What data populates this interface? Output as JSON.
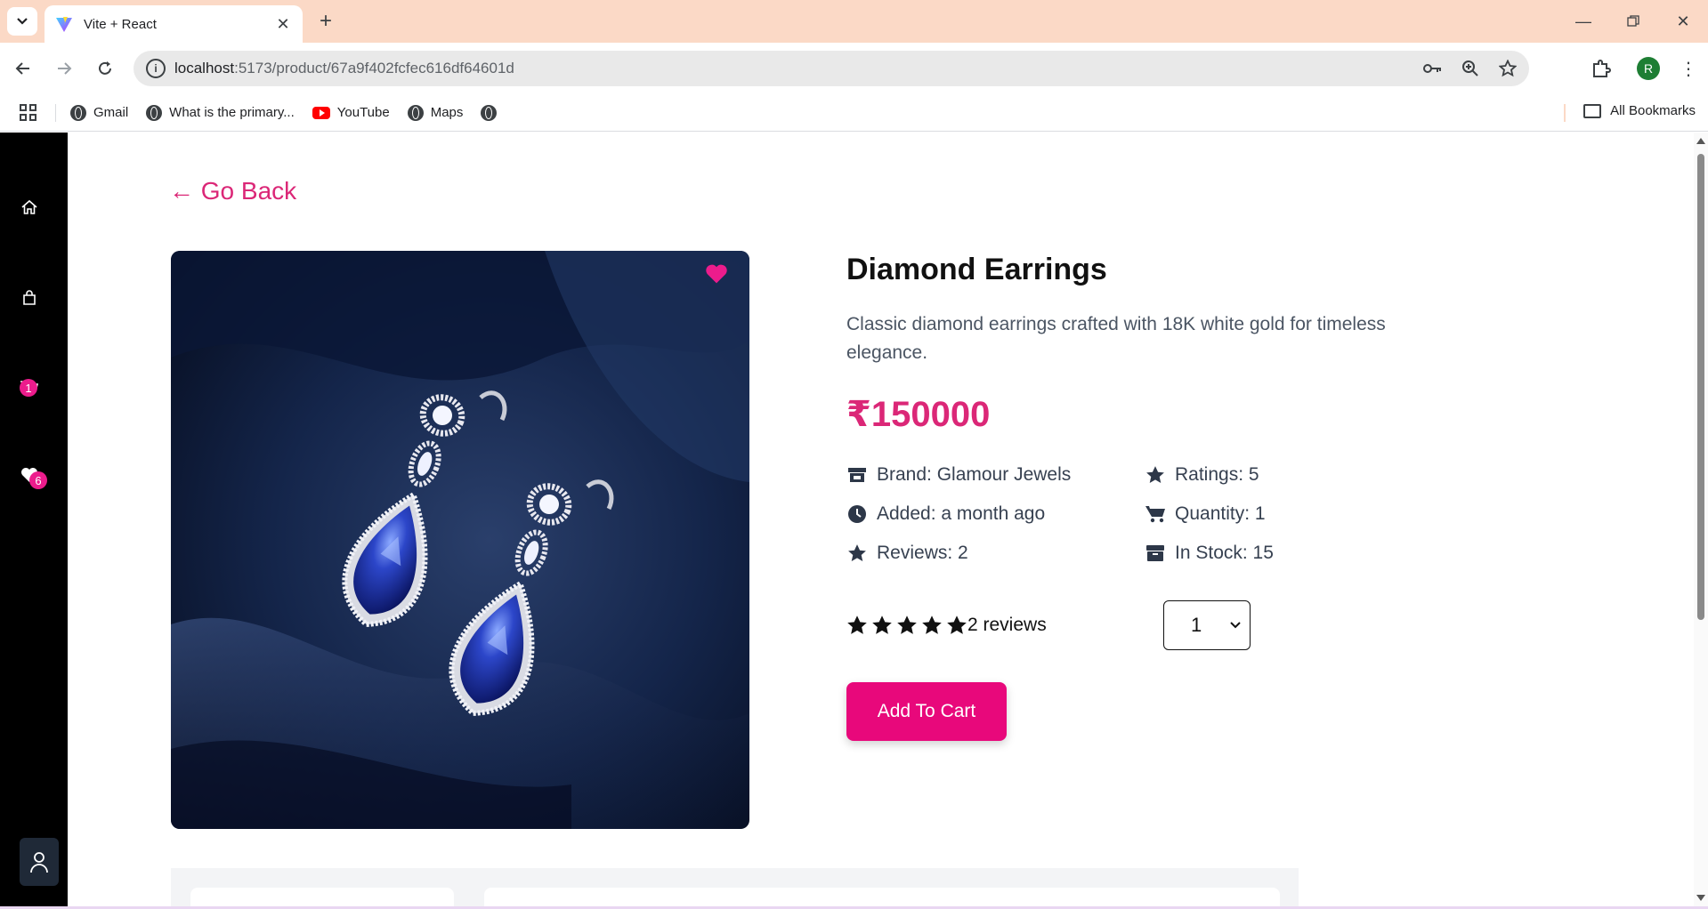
{
  "browser": {
    "tab_title": "Vite + React",
    "url_host": "localhost",
    "url_path": ":5173/product/67a9f402fcfec616df64601d",
    "bookmarks": [
      {
        "label": "Gmail",
        "icon": "globe-icon"
      },
      {
        "label": "What is the primary...",
        "icon": "globe-icon"
      },
      {
        "label": "YouTube",
        "icon": "youtube-icon"
      },
      {
        "label": "Maps",
        "icon": "globe-icon"
      },
      {
        "label": "",
        "icon": "globe-icon"
      }
    ],
    "all_bookmarks": "All Bookmarks",
    "profile_initial": "R"
  },
  "sidebar": {
    "cart_count": "1",
    "favorites_count": "6"
  },
  "page": {
    "go_back": "← Go Back"
  },
  "product": {
    "name": "Diamond Earrings",
    "description": "Classic diamond earrings crafted with 18K white gold for timeless elegance.",
    "price": "₹150000",
    "info": {
      "brand": "Brand: Glamour Jewels",
      "added": "Added: a month ago",
      "reviews": "Reviews: 2",
      "ratings": "Ratings: 5",
      "quantity": "Quantity: 1",
      "in_stock": "In Stock: 15"
    },
    "rating_stars": 5,
    "reviews_text": "2 reviews",
    "selected_qty": "1",
    "add_to_cart": "Add To Cart"
  },
  "colors": {
    "accent": "#db2777",
    "button": "#e8087b",
    "sidebar": "#000000",
    "tabstrip": "#fbd9c6"
  }
}
